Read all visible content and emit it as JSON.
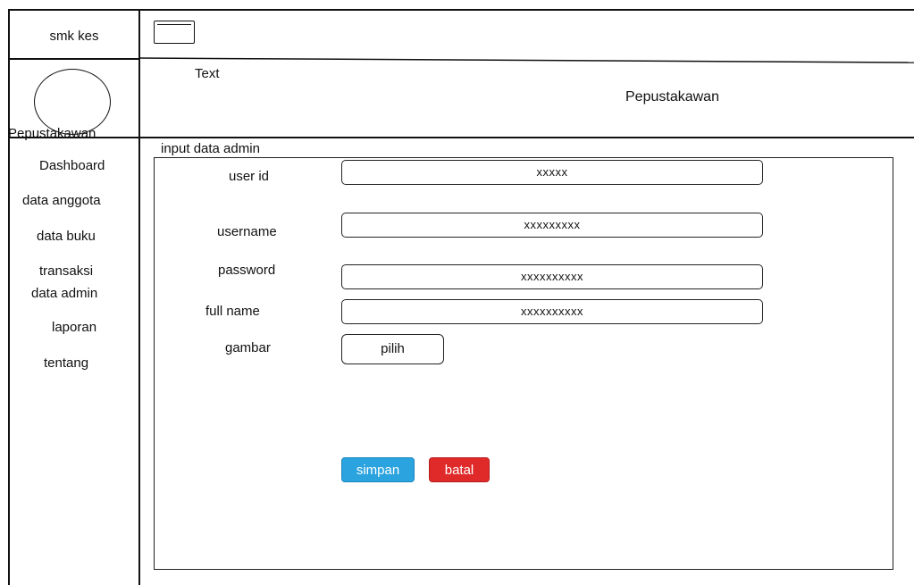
{
  "header": {
    "brand": "smk kes",
    "text_placeholder": "Text",
    "title": "Pepustakawan",
    "menu_icon": "hamburger-menu-icon"
  },
  "sidebar": {
    "profile_icon": "avatar-circle-icon",
    "profile_label": "Pepustakawan",
    "items": [
      {
        "label": "Dashboard"
      },
      {
        "label": "data anggota"
      },
      {
        "label": "data buku"
      },
      {
        "label": "transaksi"
      },
      {
        "label": "data admin"
      },
      {
        "label": "laporan"
      },
      {
        "label": "tentang"
      }
    ]
  },
  "form": {
    "title": "input data admin",
    "fields": [
      {
        "label": "user id",
        "value": "xxxxx"
      },
      {
        "label": "username",
        "value": "xxxxxxxxx"
      },
      {
        "label": "password",
        "value": "xxxxxxxxxx"
      },
      {
        "label": "full name",
        "value": "xxxxxxxxxx"
      }
    ],
    "image_label": "gambar",
    "choose_button": "pilih",
    "save_button": "simpan",
    "cancel_button": "batal"
  },
  "colors": {
    "save": "#2aa3df",
    "cancel": "#e02a2a"
  }
}
